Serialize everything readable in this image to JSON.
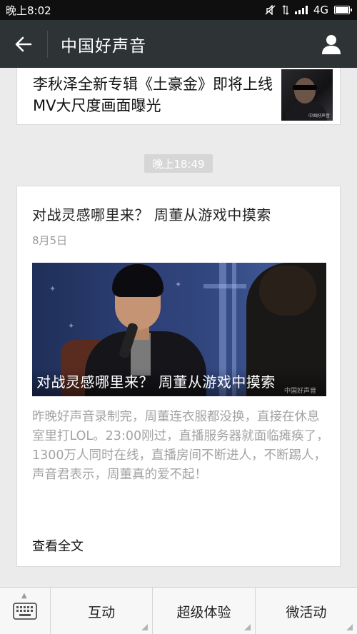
{
  "status_bar": {
    "time": "晚上8:02",
    "network": "4G",
    "battery_level": 1.0
  },
  "nav": {
    "title": "中国好声音",
    "back_icon": "arrow-left-icon",
    "profile_icon": "person-icon"
  },
  "messages": {
    "prev_article": {
      "title": "李秋泽全新专辑《土豪金》即将上线 MV大尺度画面曝光",
      "thumb_watermark": "中国好声音"
    },
    "time_label": "晚上18:49",
    "article": {
      "title": "对战灵感哪里来？ 周董从游戏中摸索",
      "date": "8月5日",
      "image_caption": "对战灵感哪里来？ 周董从游戏中摸索",
      "image_watermark": "中国好声音",
      "summary": "昨晚好声音录制完，周董连衣服都没换，直接在休息室里打LOL。23:00刚过，直播服务器就面临瘫痪了，1300万人同时在线，直播房间不断进人，不断踢人，声音君表示，周董真的爱不起！",
      "read_more": "查看全文"
    }
  },
  "bottom_menu": {
    "keyboard_icon": "keyboard-icon",
    "items": [
      {
        "label": "互动"
      },
      {
        "label": "超级体验"
      },
      {
        "label": "微活动"
      }
    ]
  }
}
